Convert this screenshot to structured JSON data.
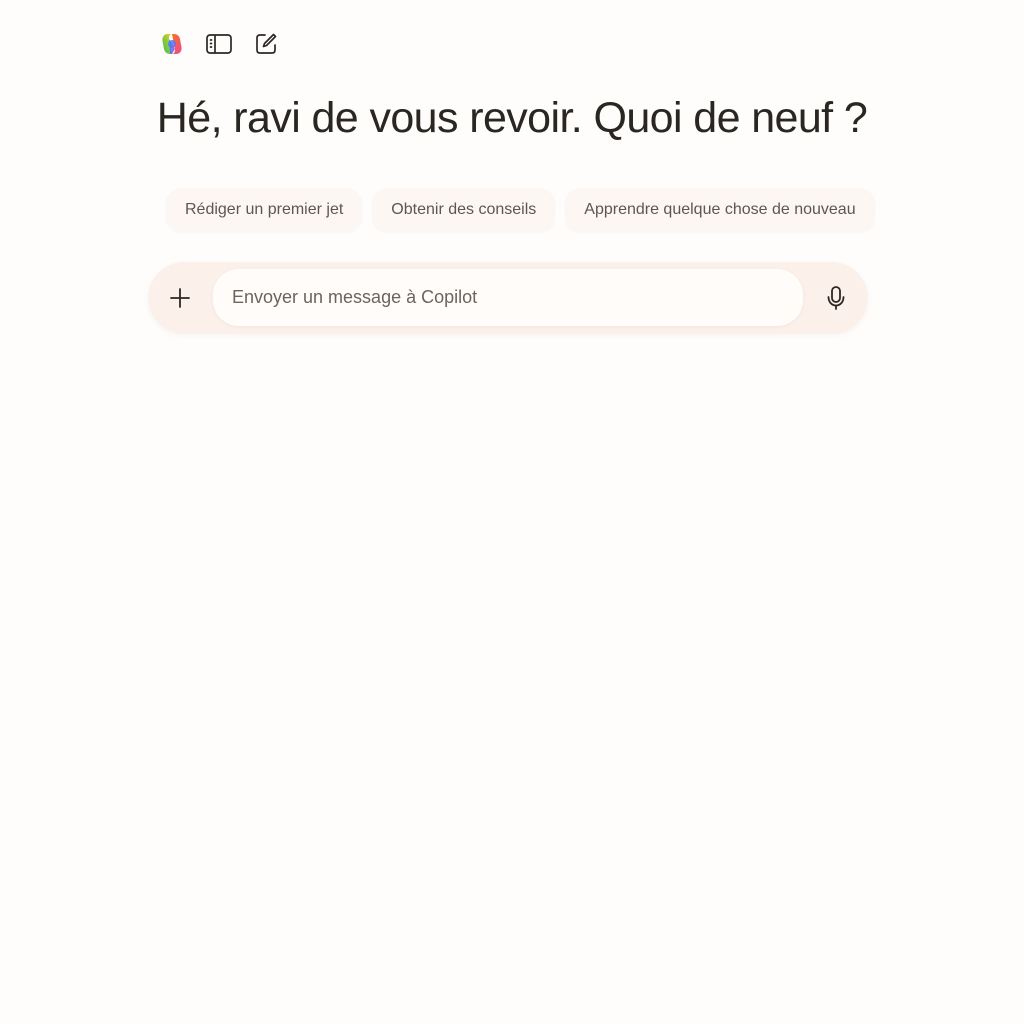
{
  "toolbar": {
    "logo_icon": "copilot-logo-icon",
    "sidebar_icon": "sidebar-toggle-icon",
    "new_chat_icon": "compose-icon"
  },
  "greeting": "Hé, ravi de vous revoir. Quoi de neuf ?",
  "suggestions": [
    "Rédiger un premier jet",
    "Obtenir des conseils",
    "Apprendre quelque chose de nouveau"
  ],
  "composer": {
    "plus_icon": "plus-icon",
    "input_value": "",
    "input_placeholder": "Envoyer un message à Copilot",
    "mic_icon": "microphone-icon"
  },
  "colors": {
    "background": "#fefdfc",
    "chip_background": "#fcf7f3",
    "composer_background": "#fbf1ea",
    "text": "#2a2622"
  }
}
